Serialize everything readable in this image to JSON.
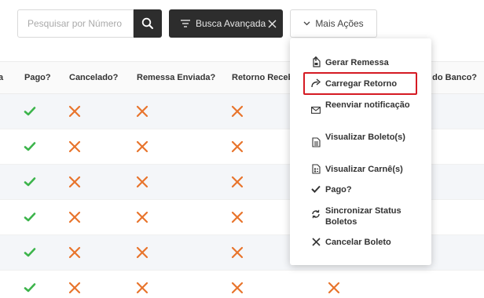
{
  "toolbar": {
    "search_placeholder": "Pesquisar por Número",
    "advanced_search_label": "Busca Avançada",
    "more_actions_label": "Mais Ações"
  },
  "table": {
    "headers": [
      "a",
      "Pago?",
      "Cancelado?",
      "Remessa Enviada?",
      "Retorno Receb",
      "a do Banco?"
    ],
    "rows": [
      {
        "pago": "check",
        "cancelado": "cross",
        "remessa": "cross",
        "retorno": "cross"
      },
      {
        "pago": "check",
        "cancelado": "cross",
        "remessa": "cross",
        "retorno": "cross"
      },
      {
        "pago": "check",
        "cancelado": "cross",
        "remessa": "cross",
        "retorno": "cross"
      },
      {
        "pago": "check",
        "cancelado": "cross",
        "remessa": "cross",
        "retorno": "cross"
      },
      {
        "pago": "check",
        "cancelado": "cross",
        "remessa": "cross",
        "retorno": "cross"
      },
      {
        "pago": "check",
        "cancelado": "cross",
        "remessa": "cross",
        "retorno": "cross",
        "extra": "cross"
      }
    ]
  },
  "menu": {
    "items": [
      {
        "label": "Gerar Remessa",
        "icon": "file-upload-icon"
      },
      {
        "label": "Carregar Retorno",
        "icon": "share-arrow-icon"
      },
      {
        "label": "Reenviar notificação",
        "icon": "envelope-icon"
      },
      {
        "label": "Visualizar Boleto(s)",
        "icon": "document-icon"
      },
      {
        "label": "Visualizar Carnê(s)",
        "icon": "document-list-icon"
      },
      {
        "label": "Pago?",
        "icon": "check-icon"
      },
      {
        "label": "Sincronizar Status Boletos",
        "icon": "sync-icon"
      },
      {
        "label": "Cancelar Boleto",
        "icon": "close-icon"
      }
    ]
  },
  "colors": {
    "check": "#3cb44b",
    "cross": "#e8742c",
    "dark_button": "#2d2d2d",
    "highlight": "#d51a23"
  }
}
